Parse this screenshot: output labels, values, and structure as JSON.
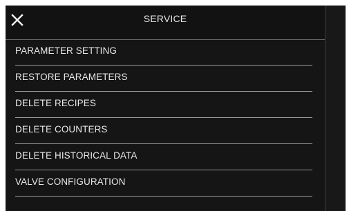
{
  "header": {
    "title": "SERVICE",
    "close_icon": "close-icon"
  },
  "menu": {
    "items": [
      {
        "label": "PARAMETER SETTING"
      },
      {
        "label": "RESTORE PARAMETERS"
      },
      {
        "label": "DELETE RECIPES"
      },
      {
        "label": "DELETE COUNTERS"
      },
      {
        "label": "DELETE HISTORICAL DATA"
      },
      {
        "label": "VALVE CONFIGURATION"
      }
    ]
  },
  "colors": {
    "background": "#151515",
    "text": "#e8e8e8",
    "divider": "#9a9a9a"
  }
}
